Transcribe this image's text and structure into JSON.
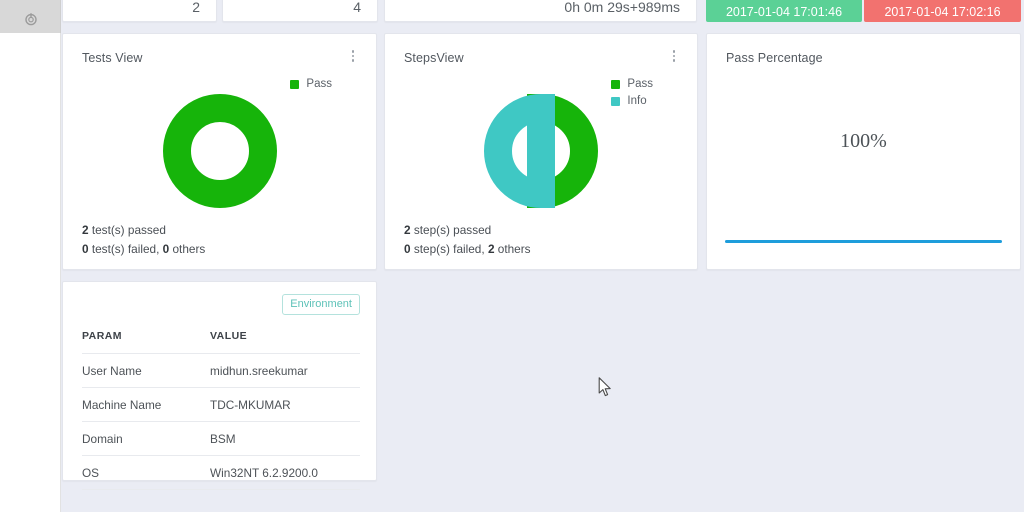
{
  "colors": {
    "page_background": "#eaecf4",
    "card_background": "#ffffff",
    "pass_green": "#16b40a",
    "info_teal": "#3fc8c4",
    "start_chip_green": "#5bd196",
    "end_chip_red": "#f2726f",
    "progress_blue": "#1e9ddb",
    "badge_teal": "#5ec2b8"
  },
  "sidebar": {
    "icon": "power-icon"
  },
  "top_row": {
    "cards": [
      {
        "name": "count-card-1",
        "value": "2"
      },
      {
        "name": "count-card-2",
        "value": "4"
      },
      {
        "name": "duration-card",
        "value": "0h 0m 29s+989ms"
      }
    ],
    "chips": [
      {
        "name": "start-time-chip",
        "label": "2017-01-04 17:01:46",
        "color": "#5bd196"
      },
      {
        "name": "end-time-chip",
        "label": "2017-01-04 17:02:16",
        "color": "#f2726f"
      }
    ]
  },
  "tests_view": {
    "title": "Tests View",
    "menu_icon": "kebab-menu-icon",
    "legend": [
      {
        "label": "Pass",
        "color": "#16b40a"
      }
    ],
    "summary_line_1_count": "2",
    "summary_line_1_text": " test(s) passed",
    "summary_line_2": [
      {
        "count": "0",
        "text": " test(s) failed, "
      },
      {
        "count": "0",
        "text": " others"
      }
    ]
  },
  "steps_view": {
    "title": "StepsView",
    "menu_icon": "kebab-menu-icon",
    "legend": [
      {
        "label": "Pass",
        "color": "#16b40a"
      },
      {
        "label": "Info",
        "color": "#3fc8c4"
      }
    ],
    "summary_line_1_count": "2",
    "summary_line_1_text": " step(s) passed",
    "summary_line_2": [
      {
        "count": "0",
        "text": " step(s) failed, "
      },
      {
        "count": "2",
        "text": " others"
      }
    ]
  },
  "pass_percentage": {
    "title": "Pass Percentage",
    "value": "100%",
    "progress": 100
  },
  "environment": {
    "badge_label": "Environment",
    "columns": [
      "PARAM",
      "VALUE"
    ],
    "rows": [
      {
        "param": "User Name",
        "value": "midhun.sreekumar"
      },
      {
        "param": "Machine Name",
        "value": "TDC-MKUMAR"
      },
      {
        "param": "Domain",
        "value": "BSM"
      },
      {
        "param": "OS",
        "value": "Win32NT 6.2.9200.0"
      }
    ]
  },
  "chart_data": [
    {
      "type": "pie",
      "title": "Tests View",
      "variant": "donut",
      "labels": [
        "Pass"
      ],
      "values": [
        2
      ],
      "colors": [
        "#16b40a"
      ],
      "total": 2,
      "legend_position": "top-right",
      "annotations": [
        "2 test(s) passed",
        "0 test(s) failed, 0 others"
      ]
    },
    {
      "type": "pie",
      "title": "StepsView",
      "variant": "donut",
      "labels": [
        "Pass",
        "Info"
      ],
      "values": [
        2,
        2
      ],
      "colors": [
        "#16b40a",
        "#3fc8c4"
      ],
      "total": 4,
      "legend_position": "top-right",
      "annotations": [
        "2 step(s) passed",
        "0 step(s) failed, 2 others"
      ]
    },
    {
      "type": "bar",
      "title": "Pass Percentage",
      "variant": "progress",
      "categories": [
        "Pass Percentage"
      ],
      "values": [
        100
      ],
      "ylim": [
        0,
        100
      ],
      "colors": [
        "#1e9ddb"
      ],
      "data_labels": [
        "100%"
      ]
    }
  ]
}
